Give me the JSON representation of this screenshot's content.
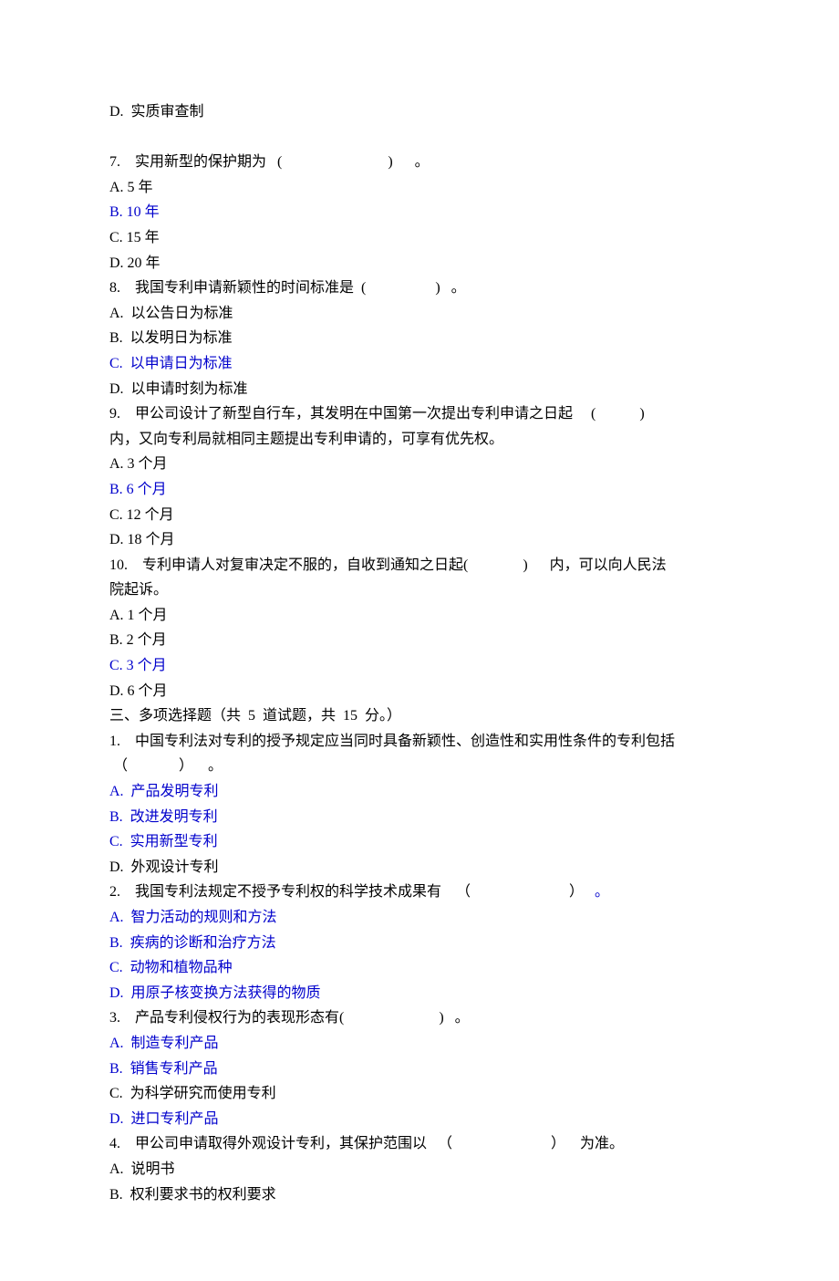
{
  "lines": [
    {
      "text": "D.  实质审查制",
      "color": "black"
    },
    {
      "text": " ",
      "color": "black"
    },
    {
      "text": "7.    实用新型的保护期为   (                             )      。",
      "color": "black"
    },
    {
      "text": "A. 5 年",
      "color": "black"
    },
    {
      "text": "B. 10 年",
      "color": "blue"
    },
    {
      "text": "C. 15 年",
      "color": "black"
    },
    {
      "text": "D. 20 年",
      "color": "black"
    },
    {
      "text": "8.    我国专利申请新颖性的时间标准是  (                   )   。",
      "color": "black"
    },
    {
      "text": "A.  以公告日为标准",
      "color": "black"
    },
    {
      "text": "B.  以发明日为标准",
      "color": "black"
    },
    {
      "text": "C.  以申请日为标准",
      "color": "blue"
    },
    {
      "text": "D.  以申请时刻为标准",
      "color": "black"
    },
    {
      "text": "9.    甲公司设计了新型自行车，其发明在中国第一次提出专利申请之日起     (            )",
      "color": "black"
    },
    {
      "text": "内，又向专利局就相同主题提出专利申请的，可享有优先权。",
      "color": "black"
    },
    {
      "text": "A. 3 个月",
      "color": "black"
    },
    {
      "text": "B. 6 个月",
      "color": "blue"
    },
    {
      "text": "C. 12 个月",
      "color": "black"
    },
    {
      "text": "D. 18 个月",
      "color": "black"
    },
    {
      "text": "10.    专利申请人对复审决定不服的，自收到通知之日起(               )      内，可以向人民法",
      "color": "black"
    },
    {
      "text": "院起诉。",
      "color": "black"
    },
    {
      "text": "A. 1 个月",
      "color": "black"
    },
    {
      "text": "B. 2 个月",
      "color": "black"
    },
    {
      "text": "C. 3 个月",
      "color": "blue"
    },
    {
      "text": "D. 6 个月",
      "color": "black"
    },
    {
      "text": "三、多项选择题（共  5  道试题，共  15  分。）",
      "color": "black"
    },
    {
      "text": "1.    中国专利法对专利的授予规定应当同时具备新颖性、创造性和实用性条件的专利包括",
      "color": "black"
    },
    {
      "text": " （              ）    。",
      "color": "black"
    },
    {
      "text": "A.  产品发明专利",
      "color": "blue"
    },
    {
      "text": "B.  改进发明专利",
      "color": "blue"
    },
    {
      "text": "C.  实用新型专利",
      "color": "blue"
    },
    {
      "text": "D.  外观设计专利",
      "color": "black"
    },
    {
      "parts": [
        {
          "text": "2.    我国专利法规定不授予专利权的科学技术成果有    （                           ）   ",
          "color": "black"
        },
        {
          "text": "。",
          "color": "blue"
        }
      ]
    },
    {
      "text": "A.  智力活动的规则和方法",
      "color": "blue"
    },
    {
      "text": "B.  疾病的诊断和治疗方法",
      "color": "blue"
    },
    {
      "text": "C.  动物和植物品种",
      "color": "blue"
    },
    {
      "text": "D.  用原子核变换方法获得的物质",
      "color": "blue"
    },
    {
      "text": "3.    产品专利侵权行为的表现形态有(                          )   。",
      "color": "black"
    },
    {
      "text": "A.  制造专利产品",
      "color": "blue"
    },
    {
      "text": "B.  销售专利产品",
      "color": "blue"
    },
    {
      "text": "C.  为科学研究而使用专利",
      "color": "black"
    },
    {
      "text": "D.  进口专利产品",
      "color": "blue"
    },
    {
      "text": "4.    甲公司申请取得外观设计专利，其保护范围以   （                           ）    为准。",
      "color": "black"
    },
    {
      "text": "A.  说明书",
      "color": "black"
    },
    {
      "text": "B.  权利要求书的权利要求",
      "color": "black"
    }
  ]
}
